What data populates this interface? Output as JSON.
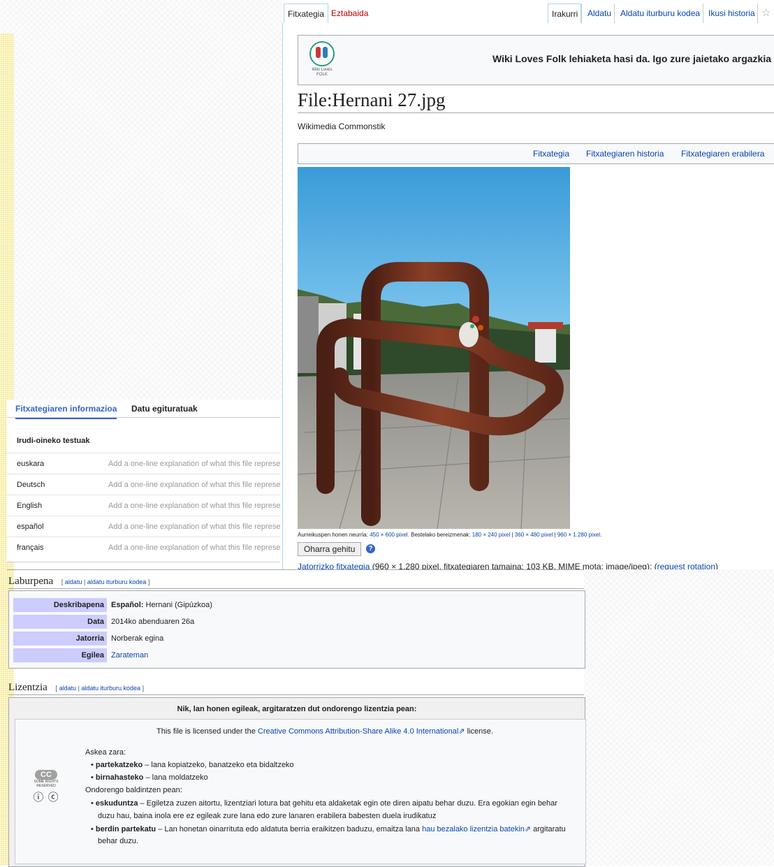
{
  "tabs": {
    "left": [
      "Fitxategia",
      "Eztabaida"
    ],
    "right": [
      "Irakurri",
      "Aldatu",
      "Aldatu iturburu kodea",
      "Ikusi historia"
    ],
    "watch_icon": "star-icon"
  },
  "banner": {
    "logo_text_line1": "Wiki Loves",
    "logo_text_line2": "FOLK",
    "message": "Wiki Loves Folk lehiaketa hasi da. Igo zure jaietako argazkia"
  },
  "page": {
    "title": "File:Hernani 27.jpg",
    "site_sub": "Wikimedia Commonstik"
  },
  "file_toc": [
    "Fitxategia",
    "Fitxategiaren historia",
    "Fitxategiaren erabilera"
  ],
  "preview": {
    "size_prefix": "Aurreikuspen honen neurria:",
    "size_value": "450 × 600 pixel",
    "other_prefix": ". Bestelako bereizmenak:",
    "res1": "180 × 240 pixel",
    "res2": "360 × 480 pixel",
    "res3": "960 × 1.280 pixel",
    "sep": "|",
    "period": ".",
    "note_button": "Oharra gehitu",
    "help_icon": "?",
    "orig_link": "Jatorrizko fitxategia",
    "orig_text": "(960 × 1.280 pixel, fitxategiaren tamaina: 103 KB, MIME mota: image/jpeg); (",
    "rotation_link": "request rotation",
    "orig_close": ")"
  },
  "info_panel": {
    "tabs": [
      "Fitxategiaren informazioa",
      "Datu egituratuak"
    ],
    "captions_header": "Irudi-oineko testuak",
    "placeholder": "Add a one-line explanation of what this file represents",
    "languages": [
      "euskara",
      "Deutsch",
      "English",
      "español",
      "français"
    ]
  },
  "summary": {
    "heading": "Laburpena",
    "edit_open": "[",
    "edit": "aldatu",
    "edit_sep": "|",
    "edit_source": "aldatu iturburu kodea",
    "edit_close": "]",
    "rows": [
      {
        "key": "Deskribapena",
        "lang": "Español:",
        "value": "Hernani (Gipúzkoa)"
      },
      {
        "key": "Data",
        "lang": "",
        "value": "2014ko abenduaren 26a"
      },
      {
        "key": "Jatorria",
        "lang": "",
        "value": "Norberak egina"
      },
      {
        "key": "Egilea",
        "lang": "",
        "value": "Zarateman"
      }
    ]
  },
  "license": {
    "heading": "Lizentzia",
    "header": "Nik, lan honen egileak, argitaratzen dut ondorengo lizentzia pean:",
    "licensed_prefix": "This file is licensed under the",
    "licensed_link": "Creative Commons Attribution-Share Alike 4.0 International",
    "licensed_suffix": "license.",
    "free": "Askea zara:",
    "share_term": "partekatzeko",
    "share_desc": "– lana kopiatzeko, banatzeko eta bidaltzeko",
    "remix_term": "birnahasteko",
    "remix_desc": "– lana moldatzeko",
    "conditions": "Ondorengo baldintzen pean:",
    "attr_term": "eskuduntza",
    "attr_desc1": "– Egiletza zuzen aitortu, lizentziari lotura bat gehitu eta aldaketak egin ote diren aipatu behar duzu. Era egokian egin behar",
    "attr_desc2": "duzu hau, baina inola ere ez egileak zure lana edo zure lanaren erabilera babesten duela irudikatuz",
    "sa_term": "berdin partekatu",
    "sa_desc1": "– Lan honetan oinarrituta edo aldatuta berria eraikitzen baduzu, emaitza lana",
    "sa_link": "hau bezalako lizentzia batekin",
    "sa_desc2": "argitaratu",
    "sa_desc3": "behar duzu.",
    "cc_badge": "CC",
    "cc_small": "SOME RIGHTS RESERVED",
    "cc_icons": "ⓘ ⓒ"
  },
  "colors": {
    "link": "#0645ad",
    "redlink": "#ba0000",
    "key_bg": "#ccccff",
    "tab_active": "#3366cc"
  }
}
